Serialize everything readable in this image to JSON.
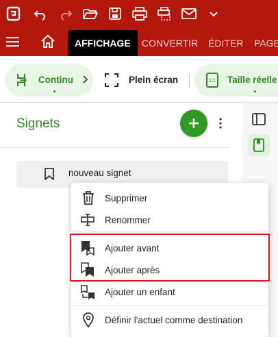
{
  "toolbar_top": {
    "icons": [
      "app-logo-icon",
      "undo-icon",
      "redo-icon",
      "open-folder-icon",
      "save-icon",
      "print-icon",
      "scan-icon",
      "mail-icon",
      "chevron-down-icon"
    ]
  },
  "menubar": {
    "tabs": [
      {
        "label": "AFFICHAGE",
        "active": true
      },
      {
        "label": "CONVERTIR",
        "active": false
      },
      {
        "label": "ÉDITER",
        "active": false
      },
      {
        "label": "PAGE",
        "active": false
      }
    ]
  },
  "view_toolbar": {
    "continuous_label": "Continu",
    "fullscreen_label": "Plein écran",
    "actual_size_label": "Taille réelle"
  },
  "bookmarks_panel": {
    "title": "Signets",
    "items": [
      {
        "label": "nouveau signet"
      }
    ]
  },
  "context_menu": {
    "items": [
      {
        "label": "Supprimer",
        "icon": "trash-icon"
      },
      {
        "label": "Renommer",
        "icon": "rename-icon"
      },
      {
        "label": "Ajouter avant",
        "icon": "bookmark-add-before-icon"
      },
      {
        "label": "Ajouter après",
        "icon": "bookmark-add-after-icon"
      },
      {
        "label": "Ajouter un enfant",
        "icon": "bookmark-add-child-icon"
      },
      {
        "label": "Définir l'actuel comme destination",
        "icon": "location-pin-icon"
      }
    ]
  },
  "colors": {
    "brand_red": "#b3160b",
    "accent_green": "#2e8b1f",
    "highlight_red": "#e0121b"
  }
}
